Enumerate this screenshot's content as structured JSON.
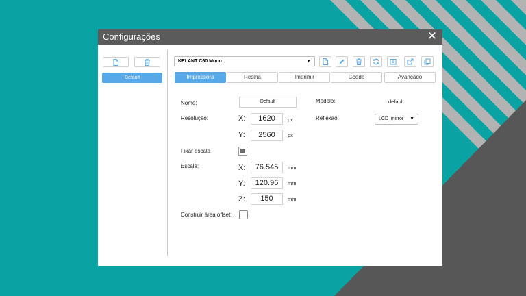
{
  "colors": {
    "background": "#0aa3a3",
    "titlebar": "#5b5b5b",
    "accent": "#56a8e8",
    "stripe": "#b3b3b3",
    "dark": "#575757"
  },
  "window": {
    "title": "Configurações",
    "close_icon": "close-icon"
  },
  "profiles": {
    "items": [
      "Default"
    ],
    "icons": [
      "new-file-icon",
      "trash-icon"
    ]
  },
  "printer_select": {
    "value": "KELANT C60 Mono"
  },
  "toolbar": {
    "icons": [
      "new-file-icon",
      "edit-pencil-icon",
      "trash-icon",
      "refresh-icon",
      "import-icon",
      "export-icon",
      "copy-icon"
    ]
  },
  "tabs": [
    "Impressora",
    "Resina",
    "Imprimir",
    "Gcode",
    "Avançado"
  ],
  "active_tab": "Impressora",
  "form": {
    "name_label": "Nome:",
    "name_value": "Default",
    "resolution_label": "Resolução:",
    "res_x_label": "X:",
    "res_x_value": "1620",
    "res_y_label": "Y:",
    "res_y_value": "2560",
    "px_unit": "px",
    "fix_scale_label": "Fixar escala",
    "fix_scale_checked": true,
    "scale_label": "Escala:",
    "scale_x_label": "X:",
    "scale_x_value": "76.545",
    "scale_y_label": "Y:",
    "scale_y_value": "120.96",
    "scale_z_label": "Z:",
    "scale_z_value": "150",
    "mm_unit": "mm",
    "offset_label": "Construir área offset:",
    "offset_checked": false,
    "model_label": "Modelo:",
    "model_value": "default",
    "reflection_label": "Reflexão:",
    "reflection_value": "LCD_mirror"
  }
}
